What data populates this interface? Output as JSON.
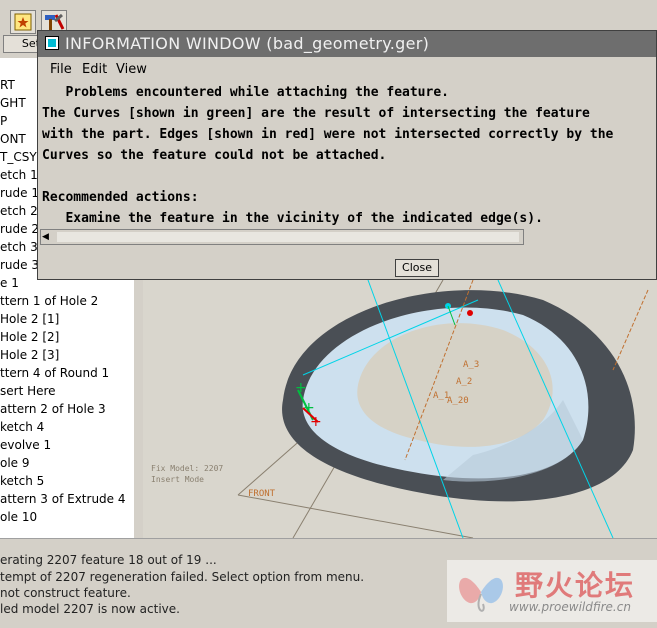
{
  "toolbar": {
    "set_label": "Set"
  },
  "model_tree": {
    "items": [
      "RT",
      "GHT",
      "P",
      "ONT",
      "T_CSYS",
      "etch 1",
      "rude 1",
      "etch 2",
      "rude 2",
      "etch 3",
      "rude 3",
      "e 1",
      "ttern 1 of Hole 2",
      "Hole 2 [1]",
      "Hole 2 [2]",
      "Hole 2 [3]",
      "ttern 4 of Round 1",
      "sert Here",
      "attern 2 of Hole 3",
      "ketch 4",
      "evolve 1",
      "ole 9",
      "ketch 5",
      "attern 3 of Extrude 4",
      "ole 10"
    ]
  },
  "info_window": {
    "title": "INFORMATION WINDOW (bad_geometry.ger)",
    "menu": {
      "file": "File",
      "edit": "Edit",
      "view": "View"
    },
    "lines": [
      "   Problems encountered while attaching the feature.",
      "The Curves [shown in green] are the result of intersecting the feature",
      "with the part. Edges [shown in red] were not intersected correctly by the",
      "Curves so the feature could not be attached.",
      "",
      "Recommended actions:",
      "   Examine the feature in the vicinity of the indicated edge(s)."
    ],
    "close_label": "Close"
  },
  "viewport": {
    "labels": {
      "a3": "A_3",
      "a2": "A_2",
      "a1": "A_1",
      "a20": "A_20",
      "front": "FRONT"
    },
    "mode_lines": [
      "Fix Model: 2207",
      "Insert Mode"
    ]
  },
  "status": {
    "lines": [
      "erating 2207 feature 18 out of 19 ...",
      "tempt of 2207 regeneration failed. Select option from menu.",
      "not construct feature.",
      "led model 2207 is now active."
    ]
  },
  "watermark": {
    "chinese": "野火论坛",
    "url": "www.proewildfire.cn"
  },
  "colors": {
    "titlebar": "#6e6e6e",
    "cyan_axis": "#00d4e8",
    "ring_dark": "#4a4f55",
    "ring_light": "#cde0ee"
  }
}
